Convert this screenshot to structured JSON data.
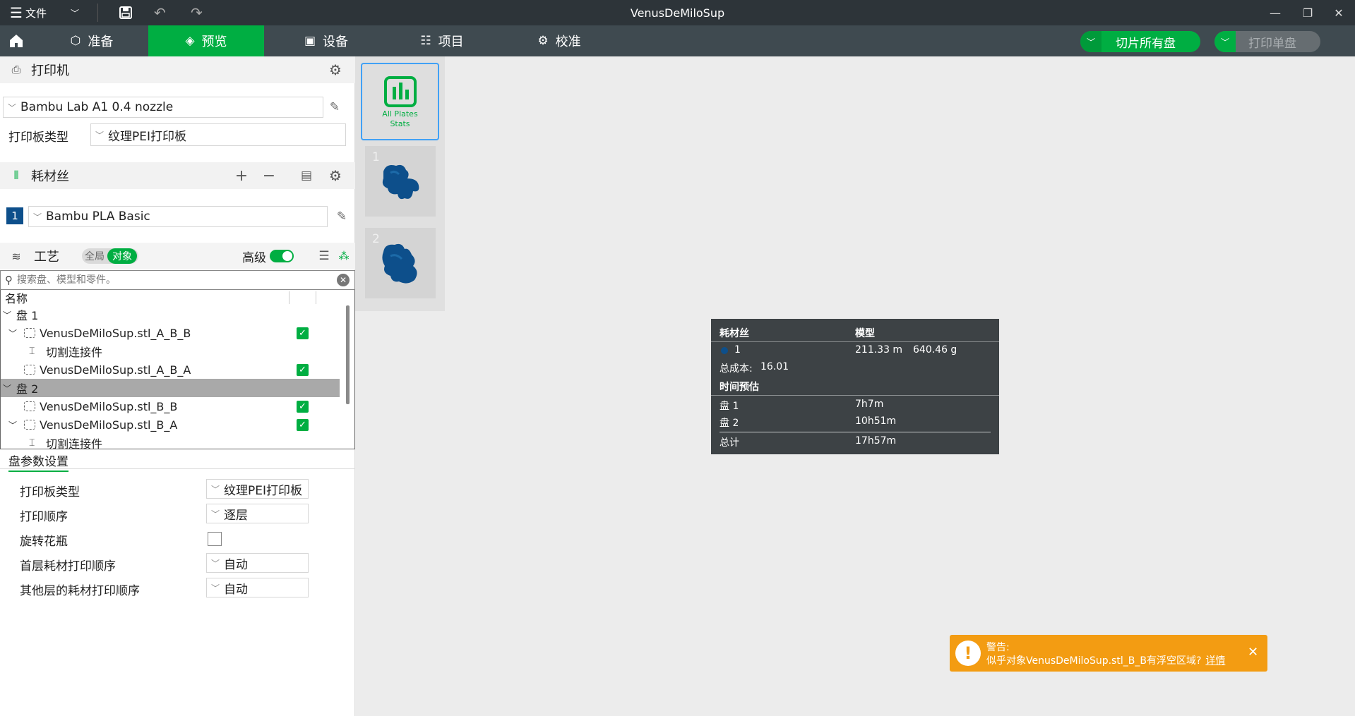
{
  "titlebar": {
    "menu_label": "文件",
    "window_title": "VenusDeMiloSup"
  },
  "nav": {
    "tabs": [
      {
        "label": "准备"
      },
      {
        "label": "预览"
      },
      {
        "label": "设备"
      },
      {
        "label": "项目"
      },
      {
        "label": "校准"
      }
    ],
    "slice_all_label": "切片所有盘",
    "print_plate_label": "打印单盘"
  },
  "printer": {
    "section_title": "打印机",
    "printer_name": "Bambu Lab A1 0.4 nozzle",
    "plate_type_label": "打印板类型",
    "plate_type_value": "纹理PEI打印板"
  },
  "filament": {
    "section_title": "耗材丝",
    "slot_number": "1",
    "filament_name": "Bambu PLA Basic"
  },
  "process": {
    "section_title": "工艺",
    "global_label": "全局",
    "object_label": "对象",
    "advanced_label": "高级",
    "advanced_on": true
  },
  "search": {
    "placeholder": "搜索盘、模型和零件。"
  },
  "tree": {
    "header": "名称",
    "rows": [
      {
        "label": "盘 1"
      },
      {
        "label": "VenusDeMiloSup.stl_A_B_B"
      },
      {
        "label": "切割连接件"
      },
      {
        "label": "VenusDeMiloSup.stl_A_B_A"
      },
      {
        "label": "盘 2"
      },
      {
        "label": "VenusDeMiloSup.stl_B_B"
      },
      {
        "label": "VenusDeMiloSup.stl_B_A"
      },
      {
        "label": "切割连接件"
      }
    ]
  },
  "plate_settings": {
    "tab_title": "盘参数设置",
    "rows": [
      {
        "label": "打印板类型",
        "value": "纹理PEI打印板"
      },
      {
        "label": "打印顺序",
        "value": "逐层"
      },
      {
        "label": "旋转花瓶",
        "value": ""
      },
      {
        "label": "首层耗材打印顺序",
        "value": "自动"
      },
      {
        "label": "其他层的耗材打印顺序",
        "value": "自动"
      }
    ],
    "spiral_vase_checked": false
  },
  "thumbs": {
    "all_plates_line1": "All Plates",
    "all_plates_line2": "Stats",
    "plates": [
      {
        "number": "1"
      },
      {
        "number": "2"
      }
    ]
  },
  "stats": {
    "filament_header": "耗材丝",
    "model_header": "模型",
    "filament_id": "1",
    "length": "211.33 m",
    "weight": "640.46 g",
    "cost_label": "总成本:",
    "cost_value": "16.01",
    "time_header": "时间预估",
    "plates": [
      {
        "label": "盘 1",
        "time": "7h7m"
      },
      {
        "label": "盘 2",
        "time": "10h51m"
      }
    ],
    "total_label": "总计",
    "total_time": "17h57m",
    "filament_color": "#0d4f8b"
  },
  "toast": {
    "title": "警告:",
    "message": "似乎对象VenusDeMiloSup.stl_B_B有浮空区域?",
    "link": "详情"
  },
  "colors": {
    "accent": "#00ae42",
    "titlebar": "#2d3439",
    "navbar": "#3f4a50",
    "warning": "#f39c12",
    "selection_border": "#41a1f5"
  }
}
